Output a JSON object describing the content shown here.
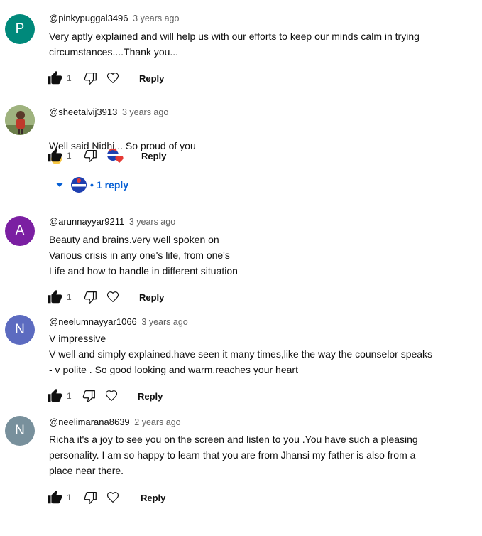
{
  "comments": [
    {
      "author": "@pinkypuggal3496",
      "time": "3 years ago",
      "avatar_letter": "P",
      "avatar_color": "#00897b",
      "text": "Very aptly explained and will help us with our efforts to keep our minds calm in trying\ncircumstances....Thank you...",
      "likes": "1",
      "reply_label": "Reply"
    },
    {
      "author": "@sheetalvij3913",
      "time": "3 years ago",
      "avatar_letter": "",
      "avatar_color": "#6d8a4e",
      "text": "Well said Nidhi... So proud of you",
      "likes": "1",
      "reply_label": "Reply",
      "replies_label": "1 reply"
    },
    {
      "author": "@arunnayyar9211",
      "time": "3 years ago",
      "avatar_letter": "A",
      "avatar_color": "#7b1fa2",
      "text": "Beauty and brains.very well spoken on\nVarious crisis in any one's life, from one's\nLife and how to handle in different situation",
      "likes": "1",
      "reply_label": "Reply"
    },
    {
      "author": "@neelumnayyar1066",
      "time": "3 years ago",
      "avatar_letter": "N",
      "avatar_color": "#5c6bc0",
      "text": "V impressive\nV well and simply explained.have seen it many times,like the way the counselor  speaks\n- v polite . So good looking and warm.reaches your heart",
      "likes": "1",
      "reply_label": "Reply"
    },
    {
      "author": "@neelimarana8639",
      "time": "2 years ago",
      "avatar_letter": "N",
      "avatar_color": "#78909c",
      "text": "Richa it's a joy to see you on the screen and listen to you .You have such a pleasing\npersonality. I am so happy to learn that you are from Jhansi my father is also from a\nplace near there.",
      "likes": "1",
      "reply_label": "Reply"
    }
  ],
  "colors": {
    "link": "#065fd4",
    "secondary_text": "#606060",
    "heart_red": "#e53935"
  },
  "icons": [
    "thumb-up-filled-icon",
    "thumb-down-icon",
    "heart-outline-icon",
    "creator-heart-icon",
    "caret-down-icon",
    "emoji-smile-icon"
  ]
}
